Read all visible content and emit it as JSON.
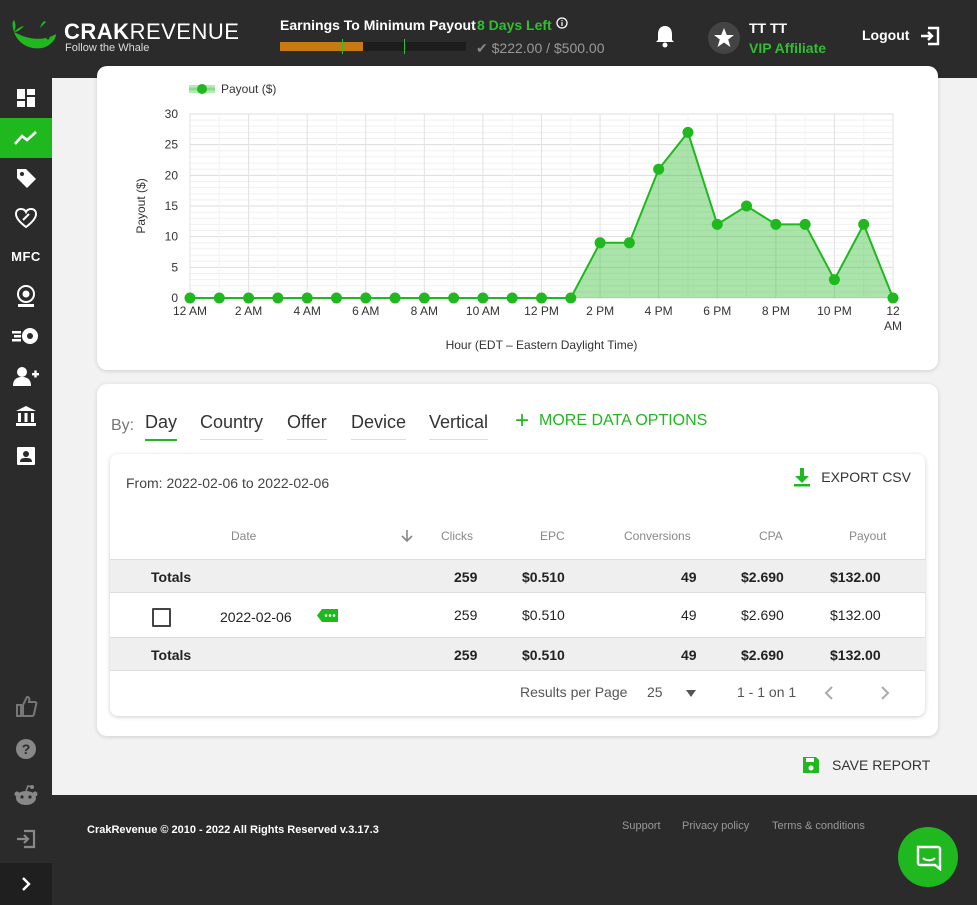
{
  "brand": {
    "name_bold": "CRAK",
    "name_light": "REVENUE",
    "tagline": "Follow the Whale"
  },
  "header": {
    "earnings_title": "Earnings To Minimum Payout",
    "days_left": "8 Days Left",
    "progress_text": "$222.00 / $500.00",
    "progress_fraction": 0.444,
    "user_name": "TT TT",
    "user_tier": "VIP Affiliate",
    "logout_label": "Logout"
  },
  "sidebar": {
    "items": [
      "dashboard-icon",
      "statistics-icon",
      "offers-tag-icon",
      "smartlinks-icon",
      "MFC",
      "webcam-icon",
      "survey-rocket-icon",
      "referral-user-plus-icon",
      "payments-bank-icon",
      "profile-card-icon"
    ],
    "bottom_items": [
      "thumbs-up-icon",
      "help-icon",
      "reddit-icon",
      "logout-icon"
    ],
    "mfc_label": "MFC"
  },
  "chart_data": {
    "type": "area",
    "legend": "Payout ($)",
    "ylabel": "Payout ($)",
    "xlabel": "Hour (EDT – Eastern Daylight Time)",
    "ylim": [
      0,
      30
    ],
    "yticks": [
      0,
      5,
      10,
      15,
      20,
      25,
      30
    ],
    "x_tick_labels": [
      "12 AM",
      "2 AM",
      "4 AM",
      "6 AM",
      "8 AM",
      "10 AM",
      "12 PM",
      "2 PM",
      "4 PM",
      "6 PM",
      "8 PM",
      "10 PM",
      "12 AM"
    ],
    "hours": [
      0,
      1,
      2,
      3,
      4,
      5,
      6,
      7,
      8,
      9,
      10,
      11,
      12,
      13,
      14,
      15,
      16,
      17,
      18,
      19,
      20,
      21,
      22,
      23,
      24
    ],
    "values": [
      0,
      0,
      0,
      0,
      0,
      0,
      0,
      0,
      0,
      0,
      0,
      0,
      0,
      0,
      9,
      9,
      21,
      27,
      12,
      15,
      12,
      12,
      3,
      12,
      0
    ],
    "color": "#1fb81f",
    "grid": true
  },
  "report": {
    "by_label": "By:",
    "tabs": [
      "Day",
      "Country",
      "Offer",
      "Device",
      "Vertical"
    ],
    "active_tab": "Day",
    "more_options": "MORE DATA OPTIONS",
    "date_range": "From: 2022-02-06 to 2022-02-06",
    "export_label": "EXPORT CSV",
    "columns": [
      "Date",
      "Clicks",
      "EPC",
      "Conversions",
      "CPA",
      "Payout"
    ],
    "totals": {
      "label": "Totals",
      "clicks": "259",
      "epc": "$0.510",
      "conversions": "49",
      "cpa": "$2.690",
      "payout": "$132.00"
    },
    "rows": [
      {
        "date": "2022-02-06",
        "clicks": "259",
        "epc": "$0.510",
        "conversions": "49",
        "cpa": "$2.690",
        "payout": "$132.00"
      }
    ],
    "results_per_page_label": "Results per Page",
    "results_per_page": "25",
    "page_info": "1 - 1 on 1",
    "save_report": "SAVE REPORT"
  },
  "footer": {
    "copyright": "CrakRevenue © 2010 - 2022 All Rights Reserved v.3.17.3",
    "links": [
      "Support",
      "Privacy policy",
      "Terms & conditions"
    ]
  }
}
